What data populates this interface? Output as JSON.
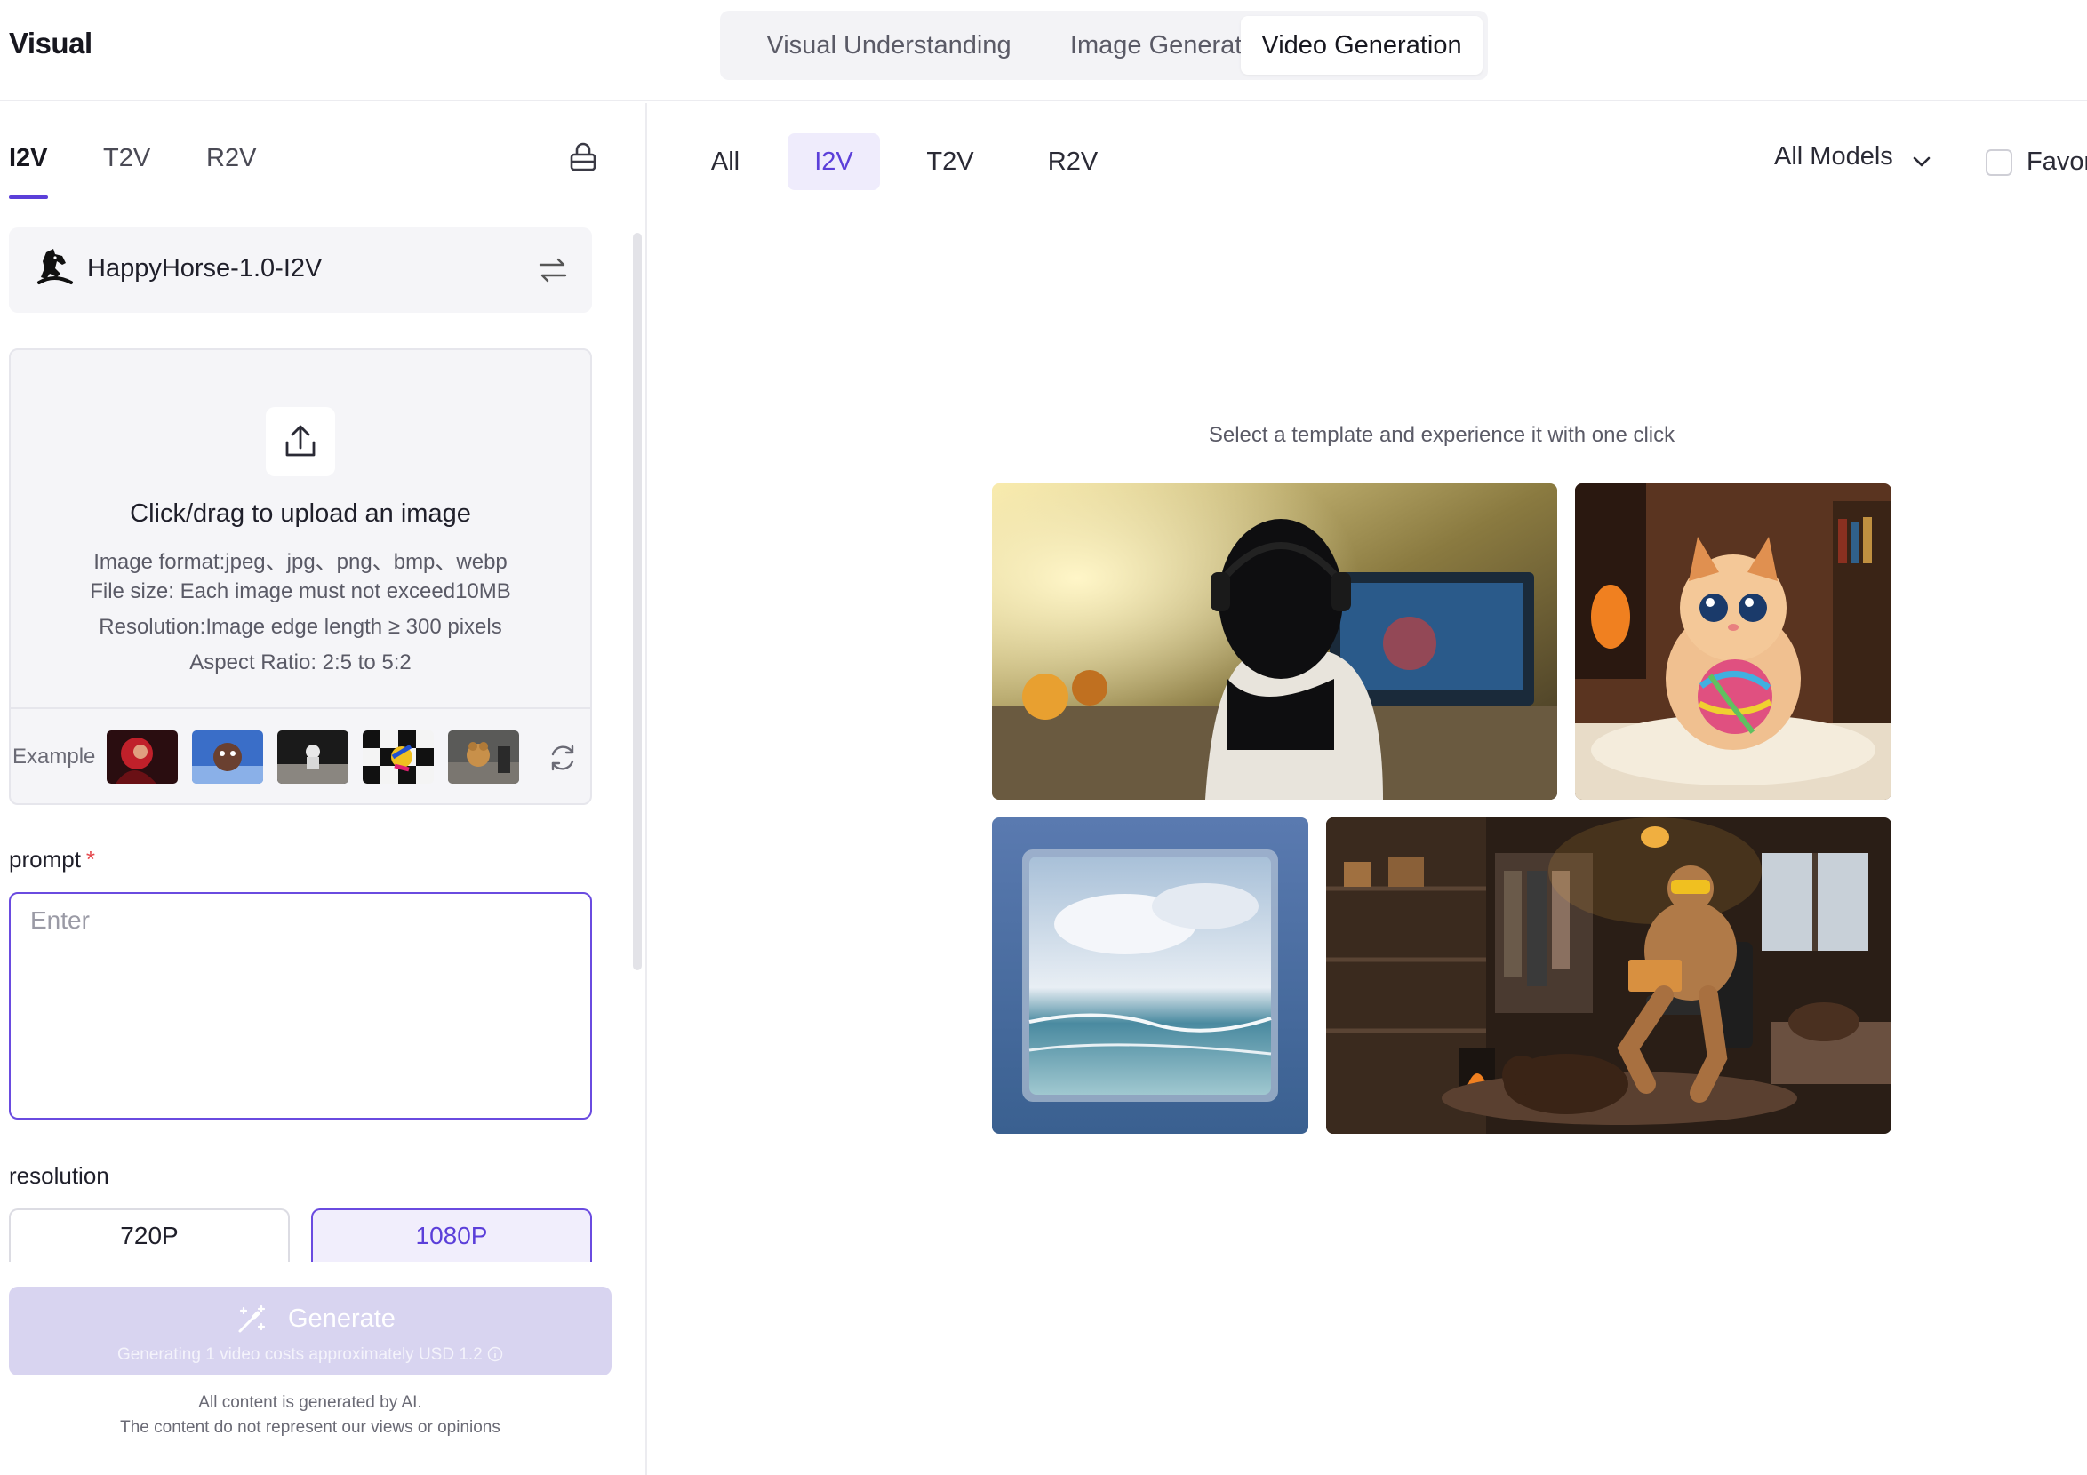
{
  "header": {
    "brand": "Visual",
    "tabs": [
      "Visual Understanding",
      "Image Generation",
      "Video Generation"
    ],
    "active_tab": "Video Generation"
  },
  "left_panel": {
    "mode_tabs": [
      "I2V",
      "T2V",
      "R2V"
    ],
    "active_mode": "I2V",
    "model": {
      "name": "HappyHorse-1.0-I2V"
    },
    "upload": {
      "title": "Click/drag to upload an image",
      "info": [
        "Image format:jpeg、jpg、png、bmp、webp",
        "File size: Each image must not exceed10MB",
        "Resolution:Image edge length ≥ 300 pixels",
        "Aspect Ratio: 2:5 to 5:2"
      ],
      "example_label": "Example"
    },
    "prompt": {
      "label": "prompt",
      "required_mark": "*",
      "placeholder": "Enter",
      "value": ""
    },
    "resolution": {
      "label": "resolution",
      "options": [
        "720P",
        "1080P"
      ],
      "selected": "1080P"
    },
    "generate": {
      "label": "Generate",
      "cost_note": "Generating 1 video costs approximately USD 1.2"
    },
    "footer": [
      "All content is generated by AI.",
      "The content do not represent our views or opinions"
    ]
  },
  "right_panel": {
    "filter_tabs": [
      "All",
      "I2V",
      "T2V",
      "R2V"
    ],
    "active_filter": "I2V",
    "model_filter": "All Models",
    "favorites_label": "Favor",
    "favorites_checked": false,
    "hint": "Select a template and experience it with one click"
  },
  "colors": {
    "accent": "#5b3fd9",
    "accent_light": "#efecfc",
    "generate_disabled": "#d8d4f0",
    "required": "#e5484d"
  }
}
